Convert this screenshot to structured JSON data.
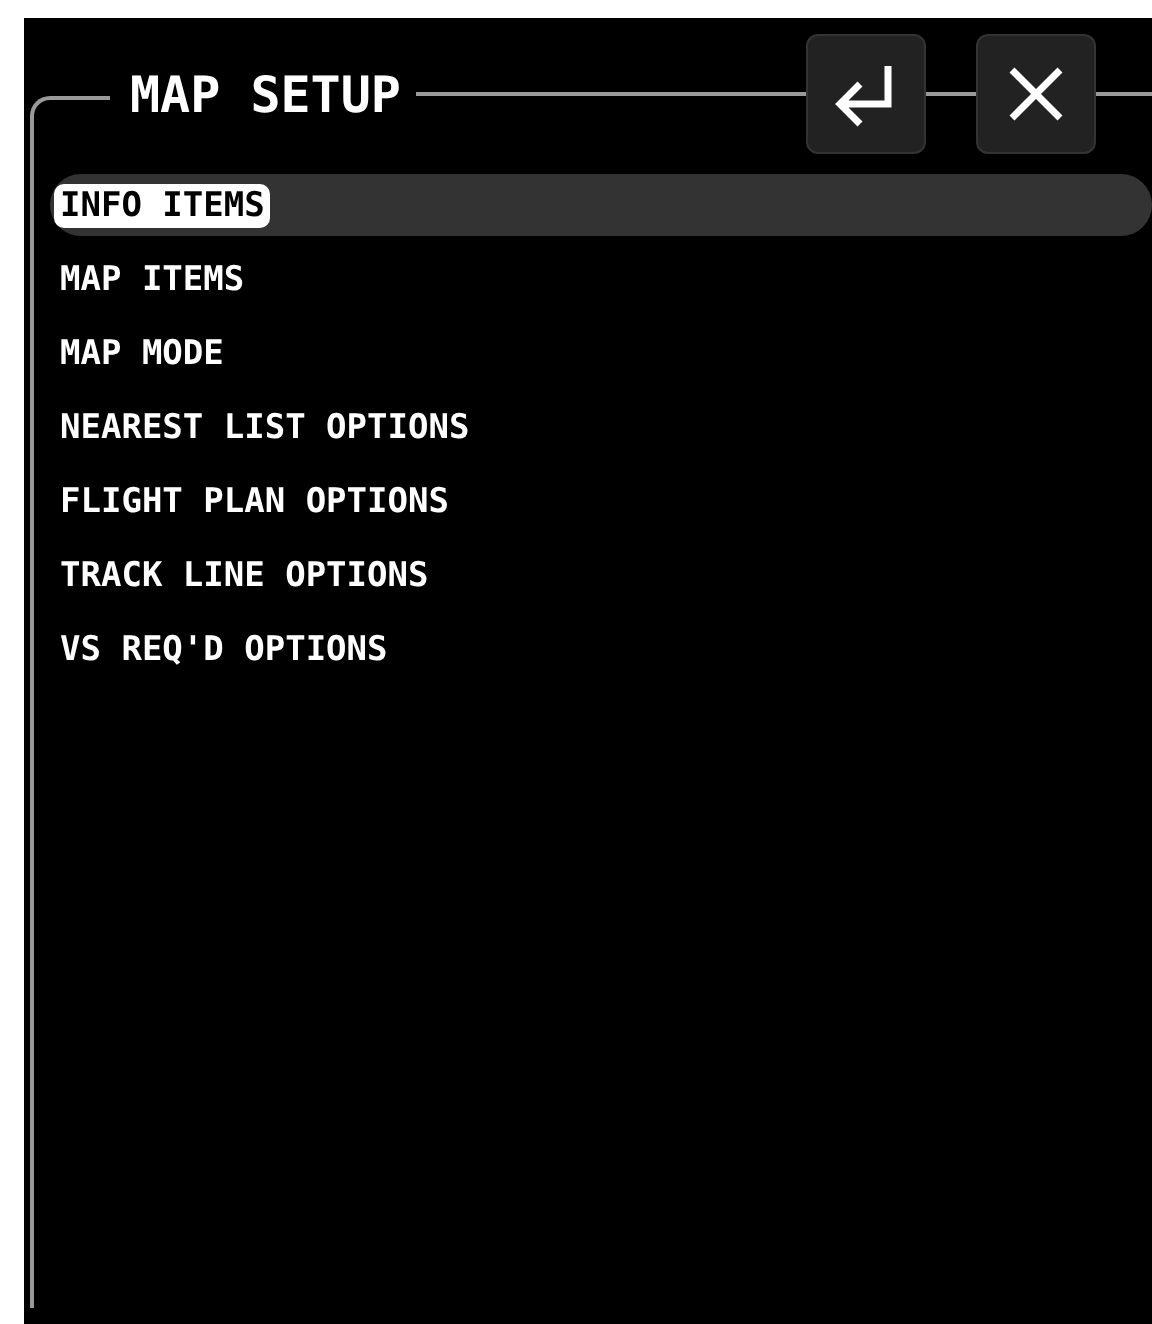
{
  "title": "MAP SETUP",
  "buttons": [
    {
      "kind": "enter"
    },
    {
      "kind": "close"
    }
  ],
  "menu_items": [
    {
      "label": "INFO ITEMS",
      "selected": true
    },
    {
      "label": "MAP ITEMS",
      "selected": false
    },
    {
      "label": "MAP MODE",
      "selected": false
    },
    {
      "label": "NEAREST LIST OPTIONS",
      "selected": false
    },
    {
      "label": "FLIGHT PLAN OPTIONS",
      "selected": false
    },
    {
      "label": "TRACK LINE OPTIONS",
      "selected": false
    },
    {
      "label": "VS REQ'D OPTIONS",
      "selected": false
    }
  ]
}
